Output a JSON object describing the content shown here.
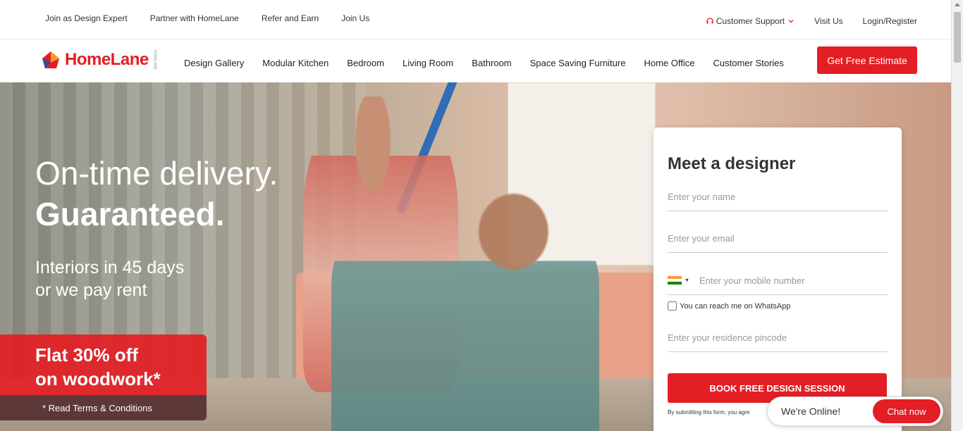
{
  "topbar": {
    "left_links": [
      "Join as Design Expert",
      "Partner with HomeLane",
      "Refer and Earn",
      "Join Us"
    ],
    "support": "Customer Support",
    "visit": "Visit Us",
    "login": "Login/Register"
  },
  "brand": {
    "name": "HomeLane",
    "sub": "HOMELANE"
  },
  "nav": {
    "items": [
      "Design Gallery",
      "Modular Kitchen",
      "Bedroom",
      "Living Room",
      "Bathroom",
      "Space Saving Furniture",
      "Home Office",
      "Customer Stories"
    ],
    "cta": "Get Free Estimate"
  },
  "hero": {
    "line1": "On-time delivery.",
    "line2": "Guaranteed.",
    "sub1": "Interiors in 45 days",
    "sub2": "or we pay rent",
    "offer1": "Flat 30% off",
    "offer2": "on woodwork*",
    "terms": "* Read Terms & Conditions"
  },
  "form": {
    "title": "Meet a designer",
    "name_placeholder": "Enter your name",
    "email_placeholder": "Enter your email",
    "mobile_placeholder": "Enter your mobile number",
    "whatsapp": "You can reach me on WhatsApp",
    "pincode_placeholder": "Enter your residence pincode",
    "submit": "BOOK FREE DESIGN SESSION",
    "disclaimer": "By submitting this form, you agre"
  },
  "chat": {
    "status": "We're Online!",
    "button": "Chat now"
  },
  "colors": {
    "brand_red": "#e31e24",
    "flag_saffron": "#ff9933",
    "flag_green": "#138808"
  }
}
